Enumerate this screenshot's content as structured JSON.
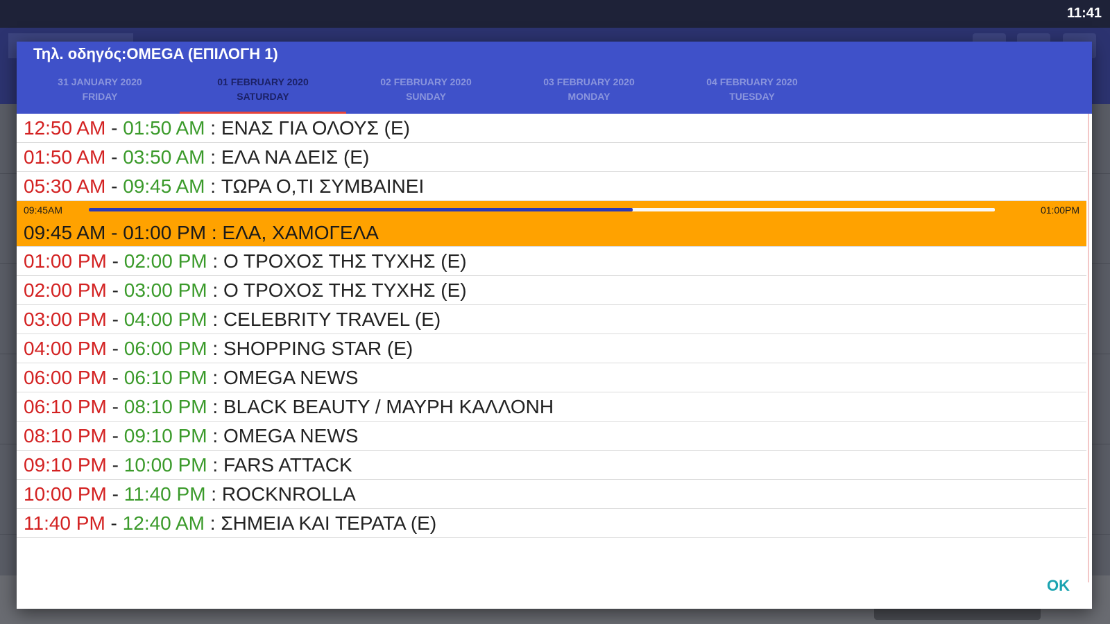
{
  "status_bar": {
    "time": "11:41"
  },
  "dialog": {
    "title": "Τηλ. οδηγός:OMEGA (ΕΠΙΛΟΓΗ 1)",
    "tabs": [
      {
        "date": "31 JANUARY 2020",
        "day": "FRIDAY",
        "active": false
      },
      {
        "date": "01 FEBRUARY 2020",
        "day": "SATURDAY",
        "active": true
      },
      {
        "date": "02 FEBRUARY 2020",
        "day": "SUNDAY",
        "active": false
      },
      {
        "date": "03 FEBRUARY 2020",
        "day": "MONDAY",
        "active": false
      },
      {
        "date": "04 FEBRUARY 2020",
        "day": "TUESDAY",
        "active": false
      }
    ],
    "programs": [
      {
        "start": "12:50 AM",
        "end": "01:50 AM",
        "title": "ΕΝΑΣ ΓΙΑ ΟΛΟΥΣ (E)"
      },
      {
        "start": "01:50 AM",
        "end": "03:50 AM",
        "title": "ΕΛΑ ΝΑ ΔΕΙΣ (E)"
      },
      {
        "start": "05:30 AM",
        "end": "09:45 AM",
        "title": "ΤΩΡΑ Ο,ΤΙ ΣΥΜΒΑΙΝΕΙ"
      },
      {
        "start": "09:45 AM",
        "end": "01:00 PM",
        "title": "ΕΛΑ, ΧΑΜΟΓΕΛΑ",
        "current": true
      },
      {
        "start": "01:00 PM",
        "end": "02:00 PM",
        "title": "Ο ΤΡΟΧΟΣ ΤΗΣ ΤΥΧΗΣ (E)"
      },
      {
        "start": "02:00 PM",
        "end": "03:00 PM",
        "title": "Ο ΤΡΟΧΟΣ ΤΗΣ ΤΥΧΗΣ (E)"
      },
      {
        "start": "03:00 PM",
        "end": "04:00 PM",
        "title": "CELEBRITY TRAVEL (E)"
      },
      {
        "start": "04:00 PM",
        "end": "06:00 PM",
        "title": "SHOPPING STAR (E)"
      },
      {
        "start": "06:00 PM",
        "end": "06:10 PM",
        "title": "OMEGA NEWS"
      },
      {
        "start": "06:10 PM",
        "end": "08:10 PM",
        "title": "BLACK BEAUTY / ΜΑΥΡΗ ΚΑΛΛΟΝΗ"
      },
      {
        "start": "08:10 PM",
        "end": "09:10 PM",
        "title": "OMEGA NEWS"
      },
      {
        "start": "09:10 PM",
        "end": "10:00 PM",
        "title": "FARS ATTACK"
      },
      {
        "start": "10:00 PM",
        "end": "11:40 PM",
        "title": "ROCKNROLLA"
      },
      {
        "start": "11:40 PM",
        "end": "12:40 AM",
        "title": "ΣΗΜΕΙΑ ΚΑΙ ΤΕΡΑΤΑ (E)"
      }
    ],
    "current_progress": {
      "start_label": "09:45AM",
      "end_label": "01:00PM",
      "fraction": 0.6
    },
    "ok_label": "OK"
  },
  "colors": {
    "header": "#3f51c9",
    "start_time": "#d32121",
    "end_time": "#3a9a2a",
    "current_row": "#ffa200",
    "progress_fill": "#2c3ab5",
    "ok": "#1aa3b0"
  }
}
